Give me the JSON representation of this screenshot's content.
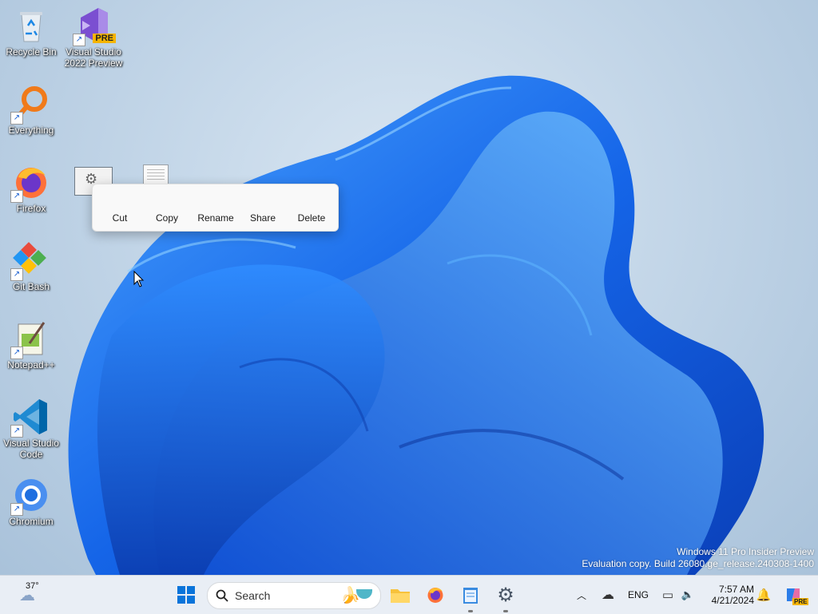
{
  "desktop": {
    "icons": [
      {
        "label": "Recycle Bin"
      },
      {
        "label": "Visual Studio 2022 Preview",
        "badge": "PRE"
      },
      {
        "label": "Everything"
      },
      {
        "label": "Firefox"
      },
      {
        "label": "Git Bash"
      },
      {
        "label": "Notepad++"
      },
      {
        "label": "Visual Studio Code"
      },
      {
        "label": "Chromium"
      }
    ]
  },
  "context_menu": {
    "items": [
      {
        "label": "Cut"
      },
      {
        "label": "Copy"
      },
      {
        "label": "Rename"
      },
      {
        "label": "Share"
      },
      {
        "label": "Delete"
      }
    ]
  },
  "watermark": {
    "line1": "Windows 11 Pro Insider Preview",
    "line2": "Evaluation copy. Build 26080.ge_release.240308-1400"
  },
  "taskbar": {
    "weather_temp": "37°",
    "search_placeholder": "Search",
    "language": "ENG",
    "time": "7:57 AM",
    "date": "4/21/2024",
    "copilot_badge": "PRE"
  },
  "colors": {
    "accent": "#0067c0",
    "wallpaper_blue": "#1565e8",
    "taskbar_bg": "#e9eef5"
  }
}
